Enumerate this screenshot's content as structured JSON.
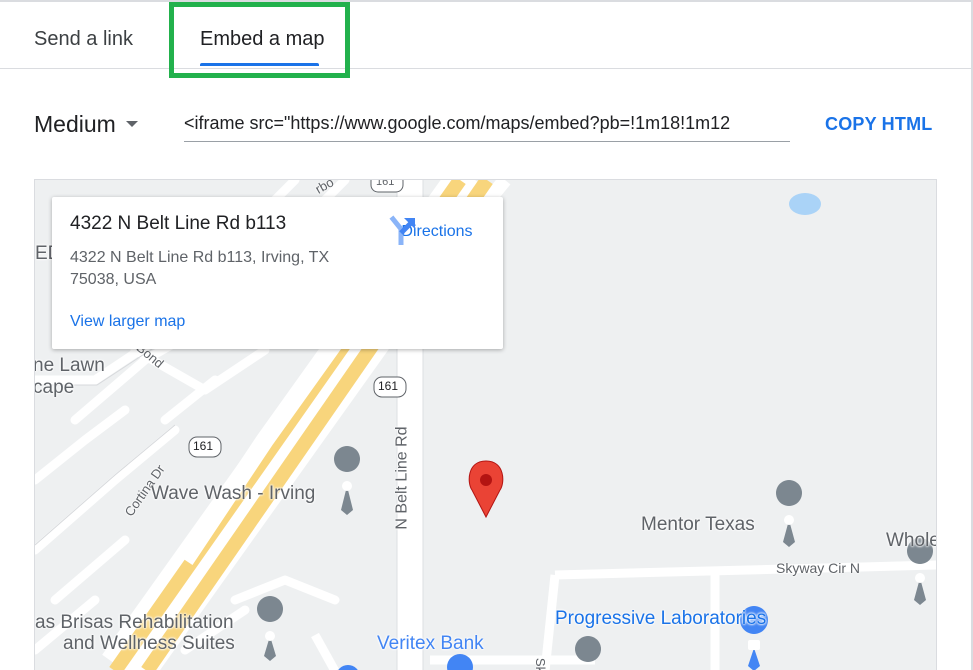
{
  "tabs": {
    "send_link": "Send a link",
    "embed_map": "Embed a map"
  },
  "size_select": {
    "selected": "Medium"
  },
  "embed_code": {
    "value": "<iframe src=\"https://www.google.com/maps/embed?pb=!1m18!1m12"
  },
  "copy_button": {
    "label": "COPY HTML"
  },
  "info_card": {
    "title": "4322 N Belt Line Rd b113",
    "address": "4322 N Belt Line Rd b113, Irving, TX 75038, USA",
    "directions_label": "Directions",
    "view_larger_label": "View larger map"
  },
  "map": {
    "labels": {
      "lawn_line1": "ne Lawn",
      "lawn_line2": "cape",
      "wave_wash": "Wave Wash - Irving",
      "belt_line_rd": "N Belt Line Rd",
      "mentor_texas": "Mentor Texas",
      "whole": "Whole",
      "skyway": "Skyway Cir N",
      "progressive": "Progressive Laboratories",
      "brisas_line1": "as Brisas Rehabilitation",
      "brisas_line2": "and Wellness Suites",
      "veritex": "Veritex Bank",
      "cortina": "Cortina Dr",
      "ed": "ED",
      "route_161_a": "161",
      "route_161_b": "161",
      "route_161_c": "161",
      "bond": "Bond",
      "sk": "Sk",
      "arbor": "rbo"
    },
    "colors": {
      "highway": "#f8d57c",
      "road": "#ffffff",
      "background": "#eef0f1",
      "pin": "#ea4335",
      "poi_pin": "#7c8790",
      "water": "#aad3f7"
    }
  }
}
